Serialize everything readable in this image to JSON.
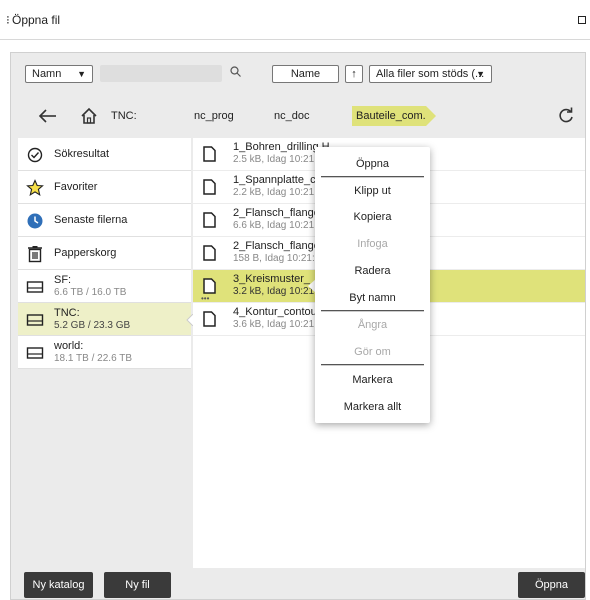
{
  "window": {
    "title": "Öppna fil"
  },
  "toolbar": {
    "sort_select": "Namn",
    "search_placeholder": "",
    "sort_button": "Name",
    "sort_direction_icon": "arrow-up-icon",
    "filter_select": "Alla filer som stöds (..."
  },
  "breadcrumb": {
    "drive": "TNC:",
    "items": [
      "nc_prog",
      "nc_doc",
      "Bauteile_com..."
    ]
  },
  "sidebar": {
    "items": [
      {
        "label": "Sökresultat",
        "sub": "",
        "icon": "search-result-icon"
      },
      {
        "label": "Favoriter",
        "sub": "",
        "icon": "star-icon"
      },
      {
        "label": "Senaste filerna",
        "sub": "",
        "icon": "clock-icon"
      },
      {
        "label": "Papperskorg",
        "sub": "",
        "icon": "trash-icon"
      },
      {
        "label": "SF:",
        "sub": "6.6 TB / 16.0 TB",
        "icon": "drive-icon"
      },
      {
        "label": "TNC:",
        "sub": "5.2 GB / 23.3 GB",
        "icon": "drive-icon"
      },
      {
        "label": "world:",
        "sub": "18.1 TB / 22.6 TB",
        "icon": "drive-icon"
      }
    ]
  },
  "files": [
    {
      "name": "1_Bohren_drilling.H",
      "meta": "2.5 kB, Idag 10:21:2"
    },
    {
      "name": "1_Spannplatte_c",
      "meta": "2.2 kB, Idag 10:21:2"
    },
    {
      "name": "2_Flansch_flange",
      "meta": "6.6 kB, Idag 10:21:2"
    },
    {
      "name": "2_Flansch_flange",
      "meta": "158 B, Idag 10:21:2"
    },
    {
      "name": "3_Kreismuster_",
      "meta": "3.2 kB, Idag 10:21:2"
    },
    {
      "name": "4_Kontur_contou",
      "meta": "3.6 kB, Idag 10:21:2"
    }
  ],
  "context_menu": {
    "items": [
      {
        "label": "Öppna",
        "disabled": false
      },
      {
        "label": "Klipp ut",
        "disabled": false
      },
      {
        "label": "Kopiera",
        "disabled": false
      },
      {
        "label": "Infoga",
        "disabled": true
      },
      {
        "label": "Radera",
        "disabled": false
      },
      {
        "label": "Byt namn",
        "disabled": false
      },
      {
        "label": "Ångra",
        "disabled": true
      },
      {
        "label": "Gör om",
        "disabled": true
      },
      {
        "label": "Markera",
        "disabled": false
      },
      {
        "label": "Markera allt",
        "disabled": false
      }
    ]
  },
  "footer": {
    "new_folder": "Ny katalog",
    "new_file": "Ny fil",
    "open": "Öppna"
  },
  "colors": {
    "accent": "#dfe27a",
    "active_sidebar": "#eef0c8",
    "dark_button": "#3a3a3a",
    "panel_bg": "#ebebeb"
  }
}
